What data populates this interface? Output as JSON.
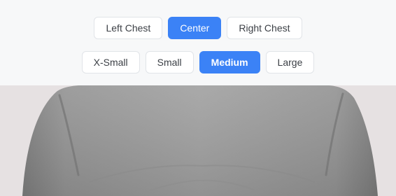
{
  "position_selector": {
    "options": [
      "Left Chest",
      "Center",
      "Right Chest"
    ],
    "selected": "Center"
  },
  "size_selector": {
    "options": [
      "X-Small",
      "Small",
      "Medium",
      "Large"
    ],
    "selected": "Medium"
  },
  "preview": {
    "garment": "gray t-shirt front view",
    "colors": {
      "shirt": "#9a9a9a",
      "backdrop": "#e6e1e2",
      "active_button": "#3b82f6"
    }
  }
}
